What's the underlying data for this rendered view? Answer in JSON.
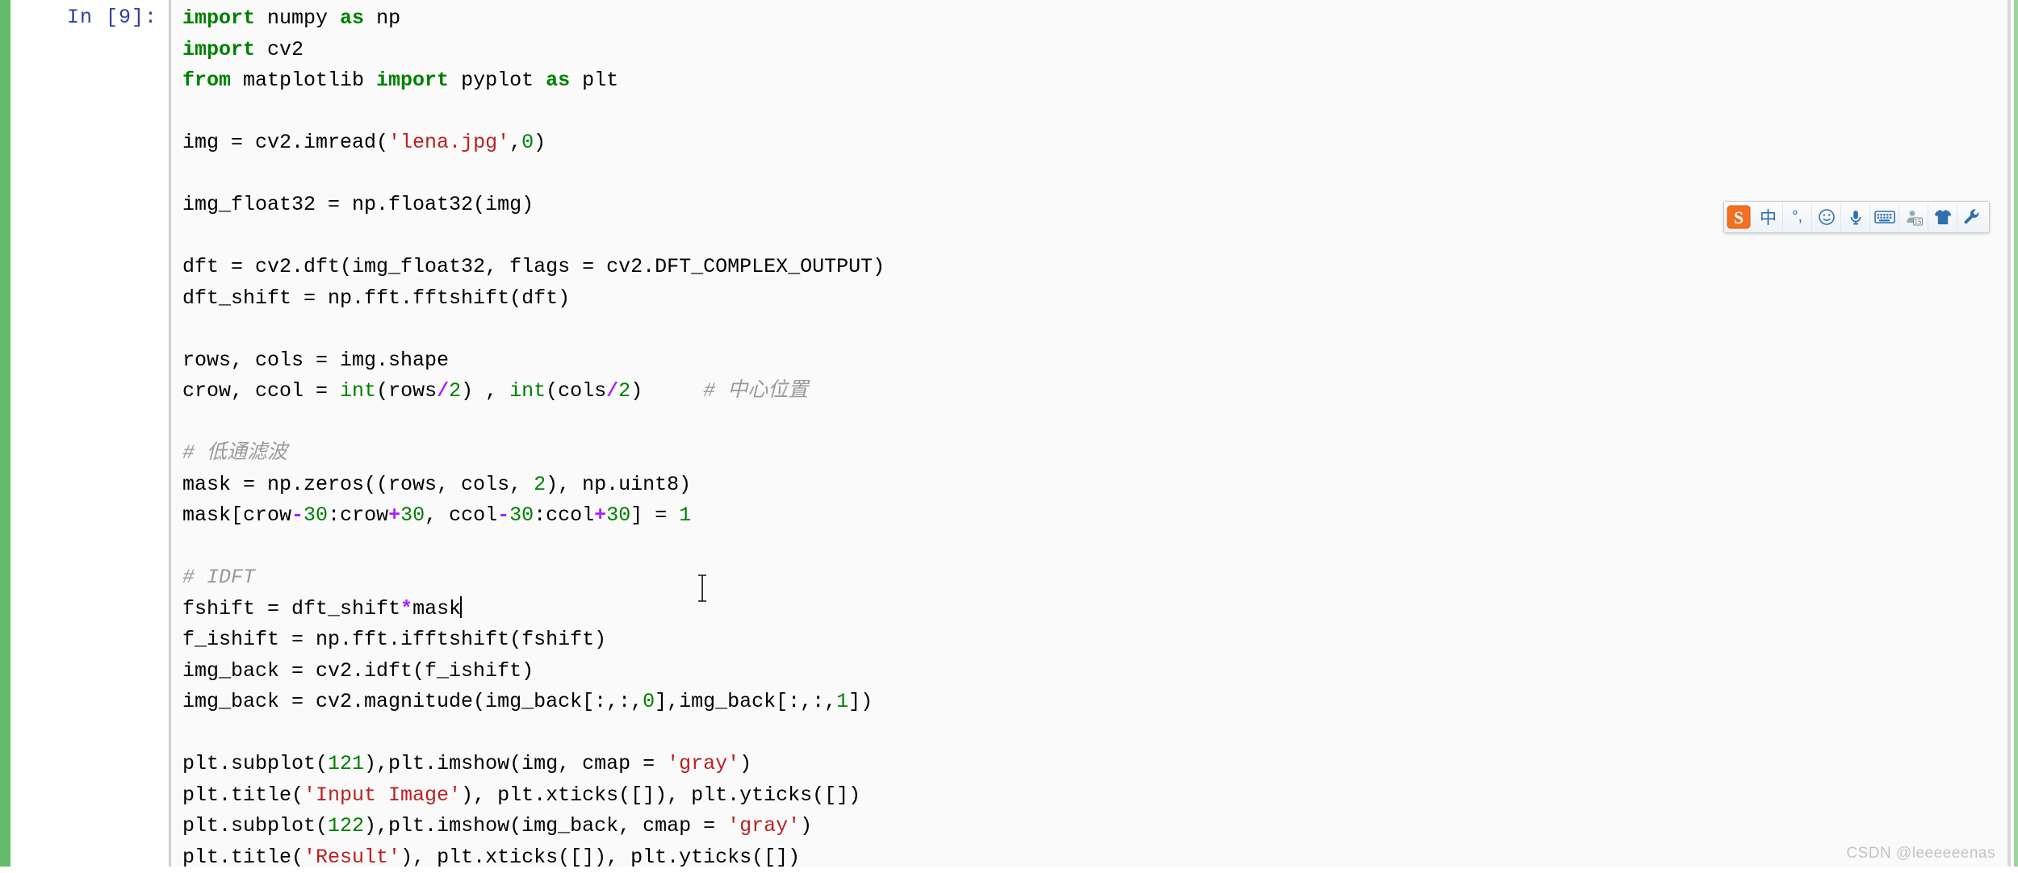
{
  "notebook": {
    "prompt_label": "In [9]:",
    "cell_type": "code",
    "selected_color": "#66bb6a",
    "cell_background": "#fafafa",
    "prompt_color": "#303F9F"
  },
  "code_lines": [
    [
      {
        "t": "import",
        "c": "kw"
      },
      {
        "t": " numpy ",
        "c": "plain"
      },
      {
        "t": "as",
        "c": "kw"
      },
      {
        "t": " np",
        "c": "plain"
      }
    ],
    [
      {
        "t": "import",
        "c": "kw"
      },
      {
        "t": " cv2",
        "c": "plain"
      }
    ],
    [
      {
        "t": "from",
        "c": "kw"
      },
      {
        "t": " matplotlib ",
        "c": "plain"
      },
      {
        "t": "import",
        "c": "kw"
      },
      {
        "t": " pyplot ",
        "c": "plain"
      },
      {
        "t": "as",
        "c": "kw"
      },
      {
        "t": " plt",
        "c": "plain"
      }
    ],
    [],
    [
      {
        "t": "img = cv2.imread(",
        "c": "plain"
      },
      {
        "t": "'lena.jpg'",
        "c": "str"
      },
      {
        "t": ",",
        "c": "plain"
      },
      {
        "t": "0",
        "c": "num"
      },
      {
        "t": ")",
        "c": "plain"
      }
    ],
    [],
    [
      {
        "t": "img_float32 = np.float32(img)",
        "c": "plain"
      }
    ],
    [],
    [
      {
        "t": "dft = cv2.dft(img_float32, flags = cv2.DFT_COMPLEX_OUTPUT)",
        "c": "plain"
      }
    ],
    [
      {
        "t": "dft_shift = np.fft.fftshift(dft)",
        "c": "plain"
      }
    ],
    [],
    [
      {
        "t": "rows, cols = img.shape",
        "c": "plain"
      }
    ],
    [
      {
        "t": "crow, ccol = ",
        "c": "plain"
      },
      {
        "t": "int",
        "c": "builtin"
      },
      {
        "t": "(rows",
        "c": "plain"
      },
      {
        "t": "/",
        "c": "op"
      },
      {
        "t": "2",
        "c": "num"
      },
      {
        "t": ") , ",
        "c": "plain"
      },
      {
        "t": "int",
        "c": "builtin"
      },
      {
        "t": "(cols",
        "c": "plain"
      },
      {
        "t": "/",
        "c": "op"
      },
      {
        "t": "2",
        "c": "num"
      },
      {
        "t": ")     ",
        "c": "plain"
      },
      {
        "t": "# 中心位置",
        "c": "comment"
      }
    ],
    [],
    [
      {
        "t": "# 低通滤波",
        "c": "comment"
      }
    ],
    [
      {
        "t": "mask = np.zeros((rows, cols, ",
        "c": "plain"
      },
      {
        "t": "2",
        "c": "num"
      },
      {
        "t": "), np.uint8)",
        "c": "plain"
      }
    ],
    [
      {
        "t": "mask[crow",
        "c": "plain"
      },
      {
        "t": "-",
        "c": "op"
      },
      {
        "t": "30",
        "c": "num"
      },
      {
        "t": ":crow",
        "c": "plain"
      },
      {
        "t": "+",
        "c": "op"
      },
      {
        "t": "30",
        "c": "num"
      },
      {
        "t": ", ccol",
        "c": "plain"
      },
      {
        "t": "-",
        "c": "op"
      },
      {
        "t": "30",
        "c": "num"
      },
      {
        "t": ":ccol",
        "c": "plain"
      },
      {
        "t": "+",
        "c": "op"
      },
      {
        "t": "30",
        "c": "num"
      },
      {
        "t": "] = ",
        "c": "plain"
      },
      {
        "t": "1",
        "c": "num"
      }
    ],
    [],
    [
      {
        "t": "# IDFT",
        "c": "comment"
      }
    ],
    [
      {
        "t": "fshift = dft_shift",
        "c": "plain"
      },
      {
        "t": "*",
        "c": "op"
      },
      {
        "t": "mask",
        "c": "plain"
      },
      {
        "t": "|CARET|",
        "c": "caret"
      }
    ],
    [
      {
        "t": "f_ishift = np.fft.ifftshift(fshift)",
        "c": "plain"
      }
    ],
    [
      {
        "t": "img_back = cv2.idft(f_ishift)",
        "c": "plain"
      }
    ],
    [
      {
        "t": "img_back = cv2.magnitude(img_back[:,:,",
        "c": "plain"
      },
      {
        "t": "0",
        "c": "num"
      },
      {
        "t": "],img_back[:,:,",
        "c": "plain"
      },
      {
        "t": "1",
        "c": "num"
      },
      {
        "t": "])",
        "c": "plain"
      }
    ],
    [],
    [
      {
        "t": "plt.subplot(",
        "c": "plain"
      },
      {
        "t": "121",
        "c": "num"
      },
      {
        "t": "),plt.imshow(img, cmap = ",
        "c": "plain"
      },
      {
        "t": "'gray'",
        "c": "str"
      },
      {
        "t": ")",
        "c": "plain"
      }
    ],
    [
      {
        "t": "plt.title(",
        "c": "plain"
      },
      {
        "t": "'Input Image'",
        "c": "str"
      },
      {
        "t": "), plt.xticks([]), plt.yticks([])",
        "c": "plain"
      }
    ],
    [
      {
        "t": "plt.subplot(",
        "c": "plain"
      },
      {
        "t": "122",
        "c": "num"
      },
      {
        "t": "),plt.imshow(img_back, cmap = ",
        "c": "plain"
      },
      {
        "t": "'gray'",
        "c": "str"
      },
      {
        "t": ")",
        "c": "plain"
      }
    ],
    [
      {
        "t": "plt.title(",
        "c": "plain"
      },
      {
        "t": "'Result'",
        "c": "str"
      },
      {
        "t": "), plt.xticks([]), plt.yticks([])",
        "c": "plain"
      }
    ]
  ],
  "ime_toolbar": {
    "name": "Sogou Input Method",
    "logo_letter": "S",
    "items": [
      {
        "icon": "chinese-mode-icon",
        "label": "中"
      },
      {
        "icon": "punctuation-icon",
        "label": "°,"
      },
      {
        "icon": "emoji-icon",
        "label": "☺"
      },
      {
        "icon": "voice-input-icon",
        "label": "🎤"
      },
      {
        "icon": "soft-keyboard-icon",
        "label": "⌨"
      },
      {
        "icon": "user-center-icon",
        "label": "15"
      },
      {
        "icon": "skin-icon",
        "label": "👕"
      },
      {
        "icon": "settings-wrench-icon",
        "label": "🔧"
      }
    ]
  },
  "watermark": {
    "text": "CSDN @leeeeeenas"
  }
}
